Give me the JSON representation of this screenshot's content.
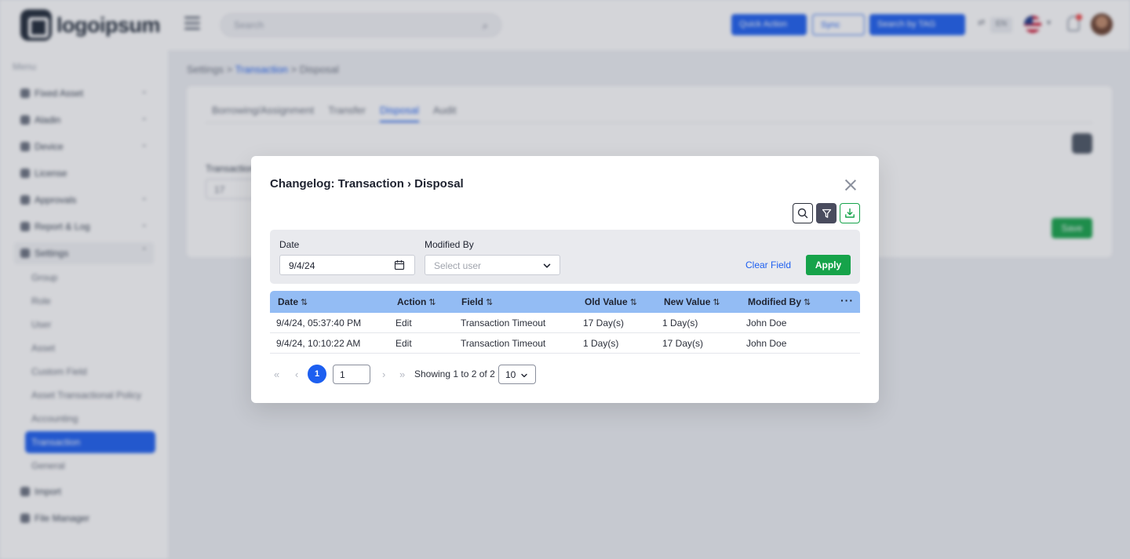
{
  "app": {
    "logo_text": "logoipsum",
    "search_placeholder": "Search",
    "buttons": {
      "quick_action": "Quick Action",
      "sync": "Sync",
      "search_by_tag": "Search by TAG"
    },
    "lang_code": "EN",
    "breadcrumb": {
      "root": "Settings",
      "sep1": ">",
      "parent": "Transaction",
      "sep2": ">",
      "current": "Disposal"
    },
    "tabs": [
      "Borrowing/Assignment",
      "Transfer",
      "Disposal",
      "Audit"
    ],
    "card": {
      "field_label": "Transaction Timeout",
      "field_value": "17",
      "save_label": "Save"
    }
  },
  "sidebar": {
    "menu_label": "Menu",
    "items": [
      {
        "label": "Fixed Asset"
      },
      {
        "label": "Aladin"
      },
      {
        "label": "Device"
      },
      {
        "label": "License"
      },
      {
        "label": "Approvals"
      },
      {
        "label": "Report & Log"
      },
      {
        "label": "Settings"
      }
    ],
    "settings_children": [
      "Group",
      "Role",
      "User",
      "Asset",
      "Custom Field",
      "Asset Transactional Policy",
      "Accounting",
      "Transaction",
      "General"
    ],
    "active_child": "Transaction",
    "bottom_items": [
      {
        "label": "Import"
      },
      {
        "label": "File Manager"
      }
    ]
  },
  "modal": {
    "title": "Changelog: Transaction › Disposal",
    "filter": {
      "date_label": "Date",
      "date_value": "9/4/24",
      "modified_by_label": "Modified By",
      "modified_by_placeholder": "Select user",
      "clear_label": "Clear Field",
      "apply_label": "Apply"
    },
    "table": {
      "columns": [
        "Date",
        "Action",
        "Field",
        "Old Value",
        "New Value",
        "Modified By"
      ],
      "rows": [
        [
          "9/4/24, 05:37:40 PM",
          "Edit",
          "Transaction Timeout",
          "17 Day(s)",
          "1 Day(s)",
          "John Doe"
        ],
        [
          "9/4/24, 10:10:22 AM",
          "Edit",
          "Transaction Timeout",
          "1 Day(s)",
          "17 Day(s)",
          "John Doe"
        ]
      ]
    },
    "pagination": {
      "current_page": "1",
      "page_input": "1",
      "info": "Showing 1 to 2 of 2",
      "page_size": "10"
    }
  },
  "colors": {
    "primary": "#1d5ff0",
    "success": "#16a34a",
    "table_header": "#93bcf4",
    "filter_bg": "#e9eaee"
  }
}
